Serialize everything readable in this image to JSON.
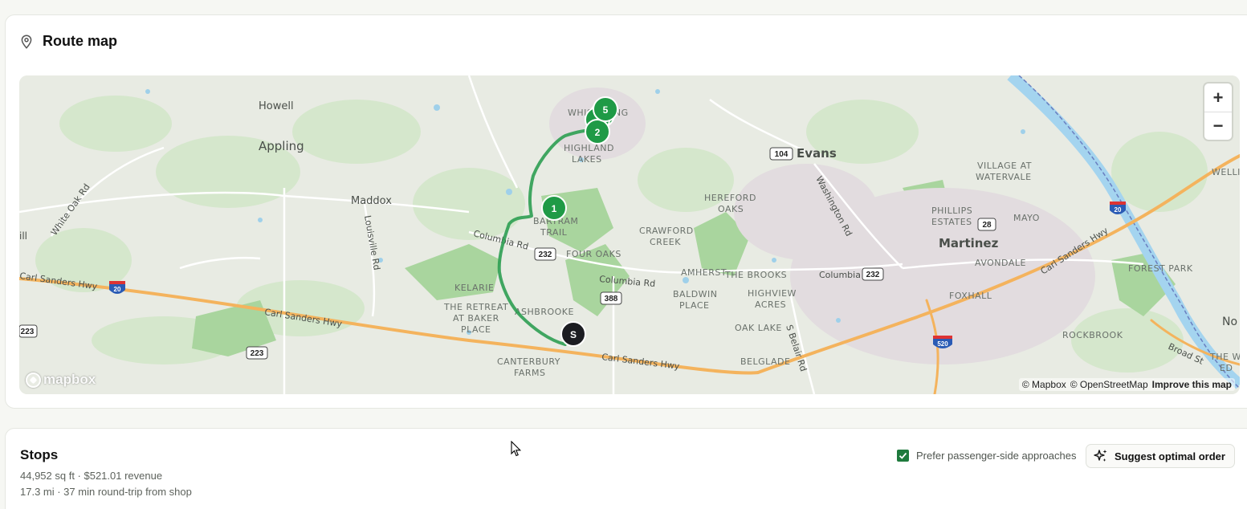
{
  "route_map": {
    "title": "Route map",
    "zoom_in_label": "+",
    "zoom_out_label": "−",
    "logo_text": "mapbox",
    "attribution": {
      "mapbox": "© Mapbox",
      "osm": "© OpenStreetMap",
      "improve": "Improve this map"
    },
    "markers": {
      "start": "S",
      "stop1": "1",
      "stop2": "2",
      "stop5": "5"
    },
    "route_color": "#2e9e52",
    "marker_color": "#1f9a46",
    "start_color": "#1c1d22",
    "places": {
      "howell": "Howell",
      "appling": "Appling",
      "maddox": "Maddox",
      "white_oak_rd": "White Oak Rd",
      "louisville_rd": "Louisville Rd",
      "columbia_rd_w": "Columbia Rd",
      "columbia_rd_c": "Columbia Rd",
      "columbia_rd_e": "Columbia Rd",
      "carl_sanders_1": "Carl Sanders Hwy",
      "carl_sanders_2": "Carl Sanders Hwy",
      "carl_sanders_3": "Carl Sanders Hwy",
      "carl_sanders_4": "Carl Sanders Hwy",
      "whispering": "WHISPERING",
      "highland": "HIGHLAND",
      "lakes": "LAKES",
      "bartram": "BARTRAM",
      "trail": "TRAIL",
      "four_oaks": "FOUR OAKS",
      "kelarie": "KELARIE",
      "retreat1": "THE RETREAT",
      "retreat2": "AT BAKER",
      "retreat3": "PLACE",
      "ashbrooke": "ASHBROOKE",
      "canterbury": "CANTERBURY",
      "farms": "FARMS",
      "hereford": "HEREFORD",
      "oaks": "OAKS",
      "crawford": "CRAWFORD",
      "creek": "CREEK",
      "amherst": "AMHERST",
      "the_brooks": "THE BROOKS",
      "baldwin": "BALDWIN",
      "place": "PLACE",
      "highview": "HIGHVIEW",
      "acres": "ACRES",
      "oak_lake": "OAK LAKE",
      "s_belair": "S Belair Rd",
      "belglade": "BELGLADE",
      "evans": "Evans",
      "washington_rd": "Washington Rd",
      "phillips": "PHILLIPS",
      "estates": "ESTATES",
      "martinez": "Martinez",
      "mayo": "MAYO",
      "village1": "VILLAGE AT",
      "village2": "WATERVALE",
      "avondale": "AVONDALE",
      "foxhall": "FOXHALL",
      "rockbrook": "ROCKBROOK",
      "forest_park": "FOREST PARK",
      "broad_st": "Broad St",
      "welli": "WELLI",
      "the_w": "THE W",
      "ed": "ED",
      "no": "No",
      "ill": "ill",
      "shield_104": "104",
      "shield_232a": "232",
      "shield_232b": "232",
      "shield_388": "388",
      "shield_223a": "223",
      "shield_223b": "223",
      "shield_28": "28",
      "shield_i20a": "20",
      "shield_i20b": "20",
      "shield_i520": "520"
    }
  },
  "stops": {
    "title": "Stops",
    "summary": "44,952 sq ft · $521.01 revenue",
    "distance": "17.3 mi · 37 min round-trip from shop",
    "prefer_label": "Prefer passenger-side approaches",
    "prefer_checked": true,
    "suggest_label": "Suggest optimal order"
  }
}
